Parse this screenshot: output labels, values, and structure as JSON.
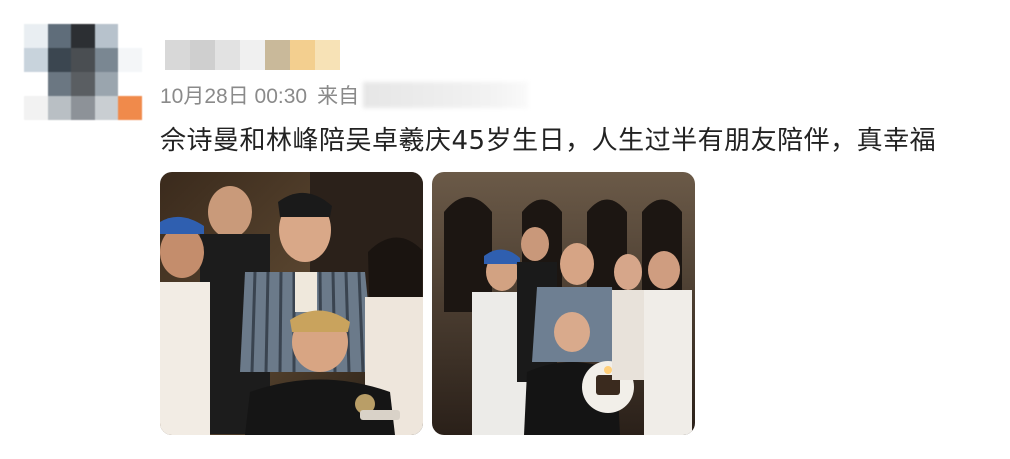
{
  "post": {
    "timestamp": "10月28日 00:30",
    "source_prefix": "来自",
    "text": "佘诗曼和林峰陪吴卓羲庆45岁生日，人生过半有朋友陪伴，真幸福"
  },
  "photos": [
    {
      "alt": "group-photo-1"
    },
    {
      "alt": "group-photo-2"
    }
  ],
  "colors": {
    "text": "#222222",
    "meta": "#8a8a8a",
    "background": "#ffffff"
  }
}
